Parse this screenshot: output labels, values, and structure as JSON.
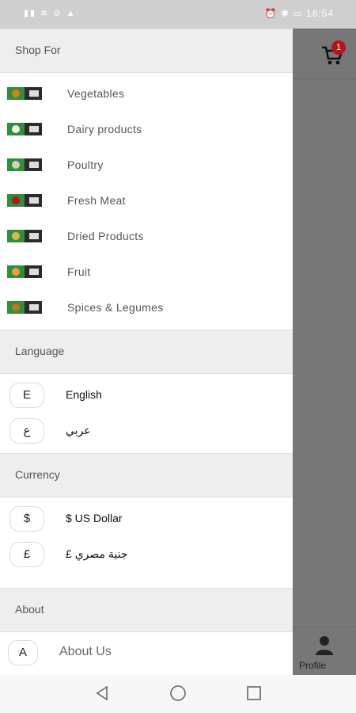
{
  "status_bar": {
    "left_icons": "sim wifi nfc warn",
    "right_icons": "alarm bluetooth battery",
    "time": "16:54"
  },
  "drawer": {
    "shop_header": "Shop For",
    "shop_items": [
      {
        "label": "Vegetables",
        "color": "#e07a1f"
      },
      {
        "label": "Dairy products",
        "color": "#f2efe4"
      },
      {
        "label": "Poultry",
        "color": "#d9cdb8"
      },
      {
        "label": "Fresh Meat",
        "color": "#b3161a"
      },
      {
        "label": "Dried Products",
        "color": "#e6b34a"
      },
      {
        "label": "Fruit",
        "color": "#e8a03a"
      },
      {
        "label": "Spices & Legumes",
        "color": "#c7702a"
      }
    ],
    "language_header": "Language",
    "languages": [
      {
        "badge": "E",
        "label": "English"
      },
      {
        "badge": "ع",
        "label": "عربي"
      }
    ],
    "currency_header": "Currency",
    "currencies": [
      {
        "badge": "$",
        "label": "$ US Dollar"
      },
      {
        "badge": "£",
        "label": "£ جنية مصري"
      }
    ],
    "about_header": "About",
    "about_items": [
      {
        "badge": "A",
        "label": "About Us"
      }
    ]
  },
  "overlay": {
    "cart_count": "1",
    "profile_label": "Profile"
  },
  "colors": {
    "accent_badge": "#b3161a",
    "section_bg": "#eeeeee",
    "overlay": "#777777"
  }
}
